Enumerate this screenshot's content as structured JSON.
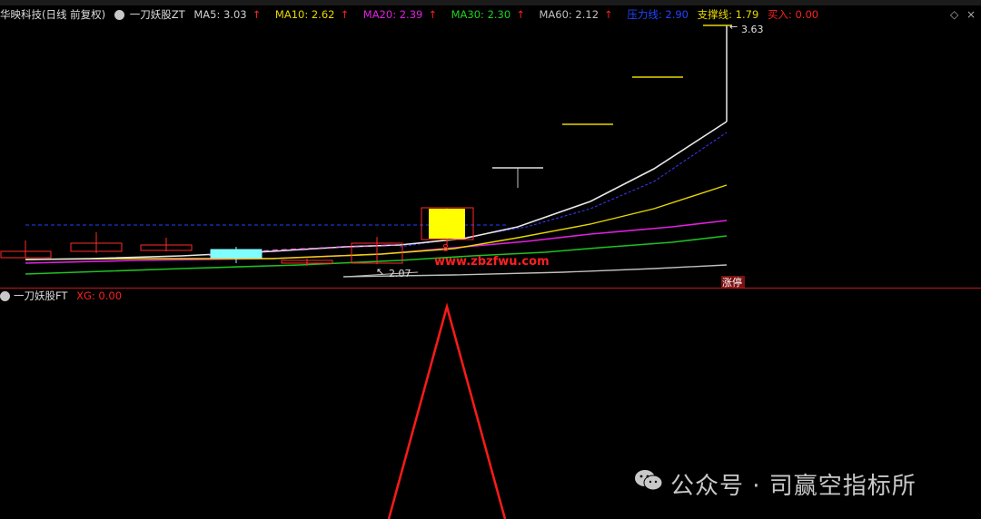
{
  "header": {
    "stock": "华映科技(日线 前复权)",
    "indicator": "一刀妖股ZT",
    "ma5": {
      "label": "MA5: 3.03",
      "color": "#d0d0d0"
    },
    "ma10": {
      "label": "MA10: 2.62",
      "color": "#e8d800"
    },
    "ma20": {
      "label": "MA20: 2.39",
      "color": "#e020e0"
    },
    "ma30": {
      "label": "MA30: 2.30",
      "color": "#20d020"
    },
    "ma60": {
      "label": "MA60: 2.12",
      "color": "#c0c0c0"
    },
    "pressure": {
      "label": "压力线: 2.90",
      "color": "#2244ff"
    },
    "support": {
      "label": "支撑线: 1.79",
      "color": "#e8d800"
    },
    "buy": {
      "label": "买入: 0.00",
      "color": "#ff2020"
    },
    "arrow": "↑"
  },
  "subchart": {
    "indicator": "一刀妖股FT",
    "xg": "XG: 0.00"
  },
  "annotations": {
    "high": "3.63",
    "low": "2.07",
    "zhangting": "涨停",
    "site": "www.zbzfwu.com"
  },
  "controls": {
    "menu": "◇",
    "close": "×"
  },
  "watermark": "公众号 · 司赢空指标所",
  "chart_data": {
    "type": "candlestick",
    "price_axis_range": [
      1.95,
      3.7
    ],
    "candles": [
      {
        "o": 2.2,
        "h": 2.23,
        "l": 2.16,
        "c": 2.17,
        "color": "red"
      },
      {
        "o": 2.21,
        "h": 2.27,
        "l": 2.18,
        "c": 2.24,
        "color": "red"
      },
      {
        "o": 2.2,
        "h": 2.26,
        "l": 2.19,
        "c": 2.23,
        "color": "red"
      },
      {
        "o": 2.2,
        "h": 2.22,
        "l": 2.15,
        "c": 2.18,
        "color": "cyan"
      },
      {
        "o": 2.14,
        "h": 2.15,
        "l": 2.12,
        "c": 2.13,
        "color": "red"
      },
      {
        "o": 2.13,
        "h": 2.23,
        "l": 2.11,
        "c": 2.24,
        "color": "red"
      },
      {
        "o": 2.39,
        "h": 2.43,
        "l": 2.23,
        "c": 2.24,
        "color": "yellow"
      },
      {
        "o": 2.7,
        "h": 2.7,
        "l": 2.55,
        "c": 2.7,
        "color": "yellow"
      },
      {
        "o": 2.9,
        "h": 2.9,
        "l": 2.9,
        "c": 2.9,
        "color": "yellow"
      },
      {
        "o": 3.14,
        "h": 3.14,
        "l": 3.14,
        "c": 3.14,
        "color": "yellow"
      },
      {
        "o": 3.07,
        "h": 3.63,
        "l": 3.07,
        "c": 3.63,
        "color": "white"
      }
    ],
    "subplot": {
      "type": "line",
      "label": "XG",
      "peak": 1
    }
  }
}
